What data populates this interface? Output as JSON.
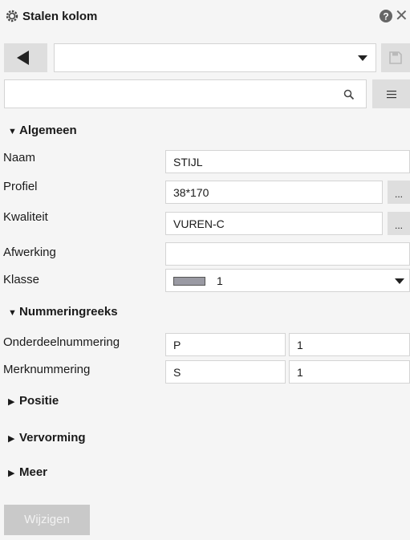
{
  "title": "Stalen kolom",
  "sections": {
    "general": "Algemeen",
    "numbering": "Nummeringreeks",
    "position": "Positie",
    "deformation": "Vervorming",
    "more": "Meer"
  },
  "fields": {
    "name": {
      "label": "Naam",
      "value": "STIJL"
    },
    "profile": {
      "label": "Profiel",
      "value": "38*170",
      "button": "..."
    },
    "quality": {
      "label": "Kwaliteit",
      "value": "VUREN-C",
      "button": "..."
    },
    "finish": {
      "label": "Afwerking",
      "value": ""
    },
    "class": {
      "label": "Klasse",
      "value": "1",
      "swatch_color": "#9a9aa3"
    }
  },
  "numbering": {
    "part": {
      "label": "Onderdeelnummering",
      "prefix": "P",
      "start": "1"
    },
    "mark": {
      "label": "Merknummering",
      "prefix": "S",
      "start": "1"
    }
  },
  "apply_button": "Wijzigen",
  "colors": {
    "panel": "#f5f5f5",
    "button_bg": "#dedede",
    "disabled_button": "#c9c9c9"
  },
  "icons": [
    "gear-icon",
    "help-icon",
    "close-icon",
    "back-arrow-icon",
    "dropdown-arrow-icon",
    "save-icon",
    "search-icon",
    "menu-icon"
  ]
}
